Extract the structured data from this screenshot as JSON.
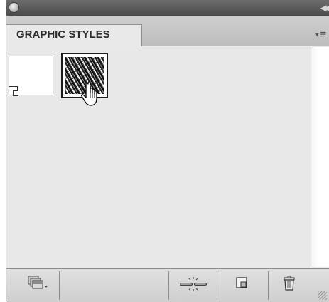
{
  "panel": {
    "tab_label": "GRAPHIC STYLES",
    "icons": {
      "close": "close-icon",
      "collapse": "double-chevron-left-icon",
      "menu": "panel-menu-icon"
    }
  },
  "styles": [
    {
      "name": "default-graphic-style",
      "selected": false
    },
    {
      "name": "scribble-graphic-style",
      "selected": true
    }
  ],
  "toolbar": {
    "buttons": [
      {
        "name": "graphic-style-libraries-menu-button",
        "icon": "libraries-icon"
      },
      {
        "name": "break-link-to-style-button",
        "icon": "break-link-icon"
      },
      {
        "name": "new-graphic-style-button",
        "icon": "new-style-icon"
      },
      {
        "name": "delete-graphic-style-button",
        "icon": "trash-icon"
      }
    ]
  },
  "colors": {
    "panel_bg": "#e9e9e9",
    "titlebar": "#555555",
    "selection_border": "#1a1a1a"
  }
}
